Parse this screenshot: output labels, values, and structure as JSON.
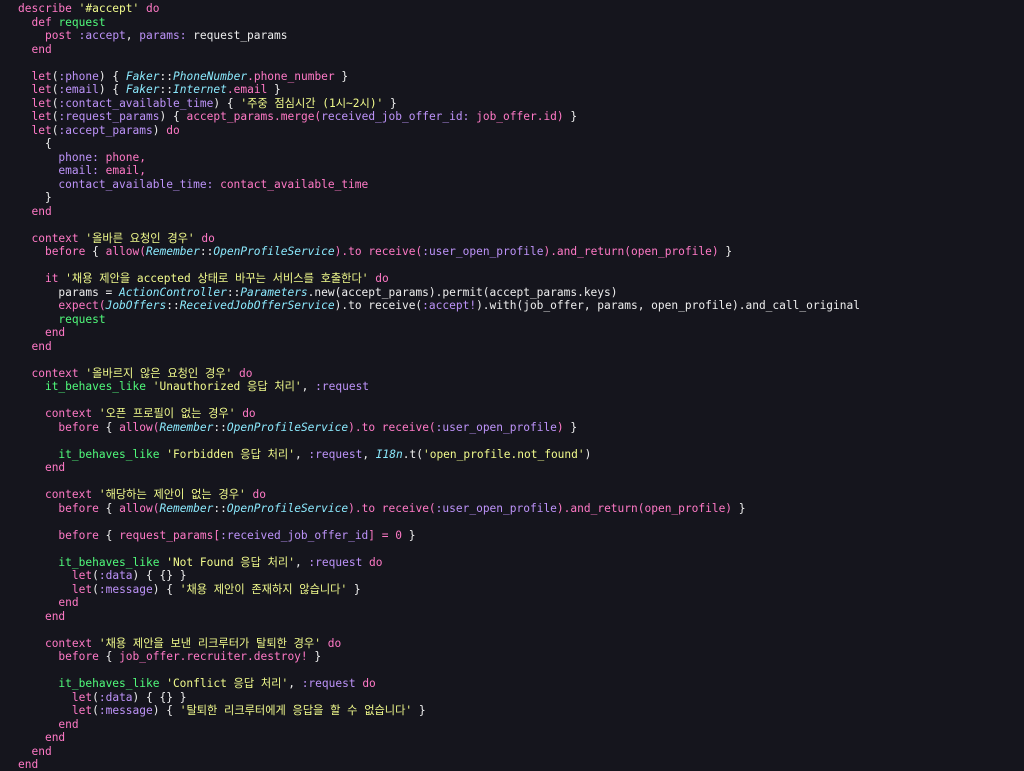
{
  "colors": {
    "background": "#15151d",
    "plain": "#ededed",
    "keyword": "#ff79c6",
    "symbol": "#bd93f9",
    "string": "#f1fa8c",
    "constant": "#8be9fd",
    "method": "#50fa7b"
  },
  "code": {
    "lines": [
      [
        [
          "k",
          "describe "
        ],
        [
          "s",
          "'#accept'"
        ],
        [
          "k",
          " do"
        ]
      ],
      [
        [
          "p",
          "  "
        ],
        [
          "k",
          "def "
        ],
        [
          "m",
          "request"
        ]
      ],
      [
        [
          "p",
          "    "
        ],
        [
          "k",
          "post "
        ],
        [
          "y",
          ":accept"
        ],
        [
          "p",
          ", "
        ],
        [
          "y",
          "params:"
        ],
        [
          "p",
          " request_params"
        ]
      ],
      [
        [
          "p",
          "  "
        ],
        [
          "k",
          "end"
        ]
      ],
      [],
      [
        [
          "p",
          "  "
        ],
        [
          "k",
          "let"
        ],
        [
          "p",
          "("
        ],
        [
          "y",
          ":phone"
        ],
        [
          "p",
          ") { "
        ],
        [
          "c",
          "Faker"
        ],
        [
          "p",
          "::"
        ],
        [
          "c",
          "PhoneNumber"
        ],
        [
          "k",
          ".phone_number"
        ],
        [
          "p",
          " }"
        ]
      ],
      [
        [
          "p",
          "  "
        ],
        [
          "k",
          "let"
        ],
        [
          "p",
          "("
        ],
        [
          "y",
          ":email"
        ],
        [
          "p",
          ") { "
        ],
        [
          "c",
          "Faker"
        ],
        [
          "p",
          "::"
        ],
        [
          "c",
          "Internet"
        ],
        [
          "k",
          ".email"
        ],
        [
          "p",
          " }"
        ]
      ],
      [
        [
          "p",
          "  "
        ],
        [
          "k",
          "let"
        ],
        [
          "p",
          "("
        ],
        [
          "y",
          ":contact_available_time"
        ],
        [
          "p",
          ") { "
        ],
        [
          "s",
          "'주중 점심시간 (1시~2시)'"
        ],
        [
          "p",
          " }"
        ]
      ],
      [
        [
          "p",
          "  "
        ],
        [
          "k",
          "let"
        ],
        [
          "p",
          "("
        ],
        [
          "y",
          ":request_params"
        ],
        [
          "p",
          ") { "
        ],
        [
          "k",
          "accept_params.merge("
        ],
        [
          "y",
          "received_job_offer_id:"
        ],
        [
          "k",
          " job_offer.id)"
        ],
        [
          "p",
          " }"
        ]
      ],
      [
        [
          "p",
          "  "
        ],
        [
          "k",
          "let"
        ],
        [
          "p",
          "("
        ],
        [
          "y",
          ":accept_params"
        ],
        [
          "p",
          ") "
        ],
        [
          "k",
          "do"
        ]
      ],
      [
        [
          "p",
          "    {"
        ]
      ],
      [
        [
          "p",
          "      "
        ],
        [
          "y",
          "phone:"
        ],
        [
          "k",
          " phone,"
        ]
      ],
      [
        [
          "p",
          "      "
        ],
        [
          "y",
          "email:"
        ],
        [
          "k",
          " email,"
        ]
      ],
      [
        [
          "p",
          "      "
        ],
        [
          "y",
          "contact_available_time:"
        ],
        [
          "k",
          " contact_available_time"
        ]
      ],
      [
        [
          "p",
          "    }"
        ]
      ],
      [
        [
          "p",
          "  "
        ],
        [
          "k",
          "end"
        ]
      ],
      [],
      [
        [
          "p",
          "  "
        ],
        [
          "k",
          "context "
        ],
        [
          "s",
          "'올바른 요청인 경우'"
        ],
        [
          "k",
          " do"
        ]
      ],
      [
        [
          "p",
          "    "
        ],
        [
          "k",
          "before"
        ],
        [
          "p",
          " { "
        ],
        [
          "k",
          "allow("
        ],
        [
          "c",
          "Remember"
        ],
        [
          "p",
          "::"
        ],
        [
          "c",
          "OpenProfileService"
        ],
        [
          "k",
          ").to receive("
        ],
        [
          "y",
          ":user_open_profile"
        ],
        [
          "k",
          ").and_return(open_profile)"
        ],
        [
          "p",
          " }"
        ]
      ],
      [],
      [
        [
          "p",
          "    "
        ],
        [
          "k",
          "it "
        ],
        [
          "s",
          "'채용 제안을 accepted 상태로 바꾸는 서비스를 호출한다'"
        ],
        [
          "k",
          " do"
        ]
      ],
      [
        [
          "p",
          "      params = "
        ],
        [
          "c",
          "ActionController"
        ],
        [
          "p",
          "::"
        ],
        [
          "c",
          "Parameters"
        ],
        [
          "p",
          ".new(accept_params).permit(accept_params.keys)"
        ]
      ],
      [
        [
          "p",
          "      "
        ],
        [
          "k",
          "expect("
        ],
        [
          "c",
          "JobOffers"
        ],
        [
          "p",
          "::"
        ],
        [
          "c",
          "ReceivedJobOfferService"
        ],
        [
          "p",
          ").to receive("
        ],
        [
          "y",
          ":accept!"
        ],
        [
          "p",
          ").with(job_offer, params, open_profile).and_call_original"
        ]
      ],
      [
        [
          "p",
          "      "
        ],
        [
          "m",
          "request"
        ]
      ],
      [
        [
          "p",
          "    "
        ],
        [
          "k",
          "end"
        ]
      ],
      [
        [
          "p",
          "  "
        ],
        [
          "k",
          "end"
        ]
      ],
      [],
      [
        [
          "p",
          "  "
        ],
        [
          "k",
          "context "
        ],
        [
          "s",
          "'올바르지 않은 요청인 경우'"
        ],
        [
          "k",
          " do"
        ]
      ],
      [
        [
          "p",
          "    "
        ],
        [
          "m",
          "it_behaves_like "
        ],
        [
          "s",
          "'Unauthorized 응답 처리'"
        ],
        [
          "p",
          ", "
        ],
        [
          "y",
          ":request"
        ]
      ],
      [],
      [
        [
          "p",
          "    "
        ],
        [
          "k",
          "context "
        ],
        [
          "s",
          "'오픈 프로필이 없는 경우'"
        ],
        [
          "k",
          " do"
        ]
      ],
      [
        [
          "p",
          "      "
        ],
        [
          "k",
          "before"
        ],
        [
          "p",
          " { "
        ],
        [
          "k",
          "allow("
        ],
        [
          "c",
          "Remember"
        ],
        [
          "p",
          "::"
        ],
        [
          "c",
          "OpenProfileService"
        ],
        [
          "k",
          ").to receive("
        ],
        [
          "y",
          ":user_open_profile"
        ],
        [
          "k",
          ")"
        ],
        [
          "p",
          " }"
        ]
      ],
      [],
      [
        [
          "p",
          "      "
        ],
        [
          "m",
          "it_behaves_like "
        ],
        [
          "s",
          "'Forbidden 응답 처리'"
        ],
        [
          "p",
          ", "
        ],
        [
          "y",
          ":request"
        ],
        [
          "p",
          ", "
        ],
        [
          "c",
          "I18n"
        ],
        [
          "p",
          ".t("
        ],
        [
          "s",
          "'open_profile.not_found'"
        ],
        [
          "p",
          ")"
        ]
      ],
      [
        [
          "p",
          "    "
        ],
        [
          "k",
          "end"
        ]
      ],
      [],
      [
        [
          "p",
          "    "
        ],
        [
          "k",
          "context "
        ],
        [
          "s",
          "'해당하는 제안이 없는 경우'"
        ],
        [
          "k",
          " do"
        ]
      ],
      [
        [
          "p",
          "      "
        ],
        [
          "k",
          "before"
        ],
        [
          "p",
          " { "
        ],
        [
          "k",
          "allow("
        ],
        [
          "c",
          "Remember"
        ],
        [
          "p",
          "::"
        ],
        [
          "c",
          "OpenProfileService"
        ],
        [
          "k",
          ").to receive("
        ],
        [
          "y",
          ":user_open_profile"
        ],
        [
          "k",
          ").and_return(open_profile)"
        ],
        [
          "p",
          " }"
        ]
      ],
      [],
      [
        [
          "p",
          "      "
        ],
        [
          "k",
          "before"
        ],
        [
          "p",
          " { "
        ],
        [
          "k",
          "request_params["
        ],
        [
          "y",
          ":received_job_offer_id"
        ],
        [
          "k",
          "] = 0"
        ],
        [
          "p",
          " }"
        ]
      ],
      [],
      [
        [
          "p",
          "      "
        ],
        [
          "m",
          "it_behaves_like "
        ],
        [
          "s",
          "'Not Found 응답 처리'"
        ],
        [
          "p",
          ", "
        ],
        [
          "y",
          ":request"
        ],
        [
          "k",
          " do"
        ]
      ],
      [
        [
          "p",
          "        "
        ],
        [
          "k",
          "let"
        ],
        [
          "p",
          "("
        ],
        [
          "y",
          ":data"
        ],
        [
          "p",
          ") { {} }"
        ]
      ],
      [
        [
          "p",
          "        "
        ],
        [
          "k",
          "let"
        ],
        [
          "p",
          "("
        ],
        [
          "y",
          ":message"
        ],
        [
          "p",
          ") { "
        ],
        [
          "s",
          "'채용 제안이 존재하지 않습니다'"
        ],
        [
          "p",
          " }"
        ]
      ],
      [
        [
          "p",
          "      "
        ],
        [
          "k",
          "end"
        ]
      ],
      [
        [
          "p",
          "    "
        ],
        [
          "k",
          "end"
        ]
      ],
      [],
      [
        [
          "p",
          "    "
        ],
        [
          "k",
          "context "
        ],
        [
          "s",
          "'채용 제안을 보낸 리크루터가 탈퇴한 경우'"
        ],
        [
          "k",
          " do"
        ]
      ],
      [
        [
          "p",
          "      "
        ],
        [
          "k",
          "before"
        ],
        [
          "p",
          " { "
        ],
        [
          "k",
          "job_offer.recruiter.destroy!"
        ],
        [
          "p",
          " }"
        ]
      ],
      [],
      [
        [
          "p",
          "      "
        ],
        [
          "m",
          "it_behaves_like "
        ],
        [
          "s",
          "'Conflict 응답 처리'"
        ],
        [
          "p",
          ", "
        ],
        [
          "y",
          ":request"
        ],
        [
          "k",
          " do"
        ]
      ],
      [
        [
          "p",
          "        "
        ],
        [
          "k",
          "let"
        ],
        [
          "p",
          "("
        ],
        [
          "y",
          ":data"
        ],
        [
          "p",
          ") { {} }"
        ]
      ],
      [
        [
          "p",
          "        "
        ],
        [
          "k",
          "let"
        ],
        [
          "p",
          "("
        ],
        [
          "y",
          ":message"
        ],
        [
          "p",
          ") { "
        ],
        [
          "s",
          "'탈퇴한 리크루터에게 응답을 할 수 없습니다'"
        ],
        [
          "p",
          " }"
        ]
      ],
      [
        [
          "p",
          "      "
        ],
        [
          "k",
          "end"
        ]
      ],
      [
        [
          "p",
          "    "
        ],
        [
          "k",
          "end"
        ]
      ],
      [
        [
          "p",
          "  "
        ],
        [
          "k",
          "end"
        ]
      ],
      [
        [
          "k",
          "end"
        ]
      ]
    ]
  }
}
